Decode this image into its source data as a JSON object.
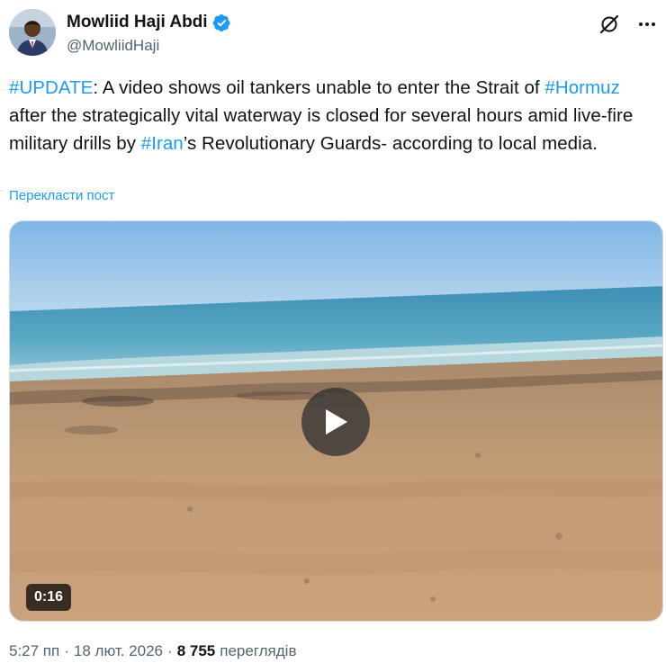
{
  "author": {
    "display_name": "Mowliid Haji Abdi",
    "handle": "@MowliidHaji",
    "verified": true,
    "avatar_icon": "person-portrait"
  },
  "actions": {
    "grok_icon": "grok-icon",
    "more_icon": "more-horizontal-icon"
  },
  "tweet": {
    "seg1_tag": "#UPDATE",
    "seg2": ": A video shows oil tankers unable to enter the Strait of ",
    "seg3_tag": "#Hormuz",
    "seg4": " after the strategically vital waterway is closed for several hours amid live-fire military drills by ",
    "seg5_tag": "#Iran",
    "seg6": "’s Revolutionary Guards- according to local media."
  },
  "translate_label": "Перекласти пост",
  "video": {
    "duration": "0:16",
    "play_icon": "play-icon"
  },
  "meta": {
    "time": "5:27 пп",
    "separator": "·",
    "date": "18 лют. 2026",
    "views_count": "8 755",
    "views_label": "переглядів"
  },
  "colors": {
    "link": "#1d9bf0",
    "verified": "#1d9bf0",
    "text": "#0f1419",
    "secondary": "#536471"
  }
}
